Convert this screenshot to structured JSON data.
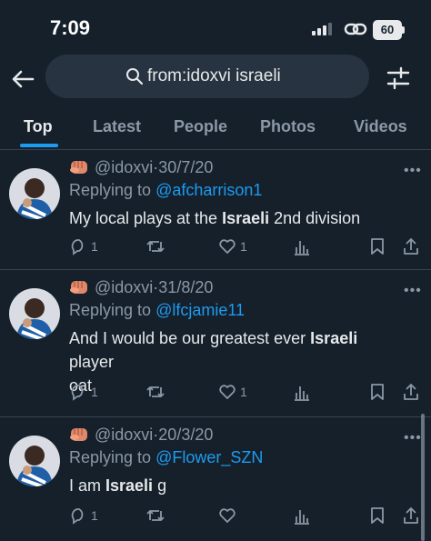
{
  "status_bar": {
    "time": "7:09",
    "battery": "60"
  },
  "search": {
    "query": "from:idoxvi israeli"
  },
  "tabs": [
    {
      "label": "Top",
      "active": true
    },
    {
      "label": "Latest",
      "active": false
    },
    {
      "label": "People",
      "active": false
    },
    {
      "label": "Photos",
      "active": false
    },
    {
      "label": "Videos",
      "active": false
    }
  ],
  "tweets": [
    {
      "handle": "@idoxvi",
      "separator": "·",
      "date": "30/7/20",
      "replying_prefix": "Replying to ",
      "replying_to": "@afcharrison1",
      "text_before": "My local plays at the ",
      "bold": "Israeli",
      "text_after": " 2nd division",
      "text_line2": "",
      "reply_count": "1",
      "retweet_count": "",
      "like_count": "1"
    },
    {
      "handle": "@idoxvi",
      "separator": "·",
      "date": "31/8/20",
      "replying_prefix": "Replying to ",
      "replying_to": "@lfcjamie11",
      "text_before": "And I would be our greatest ever ",
      "bold": "Israeli",
      "text_after": " player",
      "text_line2": "oat",
      "reply_count": "1",
      "retweet_count": "",
      "like_count": "1"
    },
    {
      "handle": "@idoxvi",
      "separator": "·",
      "date": "20/3/20",
      "replying_prefix": "Replying to ",
      "replying_to": "@Flower_SZN",
      "text_before": "I am ",
      "bold": "Israeli",
      "text_after": " g",
      "text_line2": "",
      "reply_count": "1",
      "retweet_count": "",
      "like_count": ""
    }
  ],
  "colors": {
    "background": "#15202b",
    "accent": "#1d9bf0",
    "muted": "#8b98a5",
    "text": "#e7e9ea"
  },
  "icons": [
    "back-arrow-icon",
    "search-icon",
    "filter-icon",
    "fist-emoji-icon",
    "more-icon",
    "reply-icon",
    "retweet-icon",
    "like-icon",
    "views-icon",
    "bookmark-icon",
    "share-icon"
  ]
}
